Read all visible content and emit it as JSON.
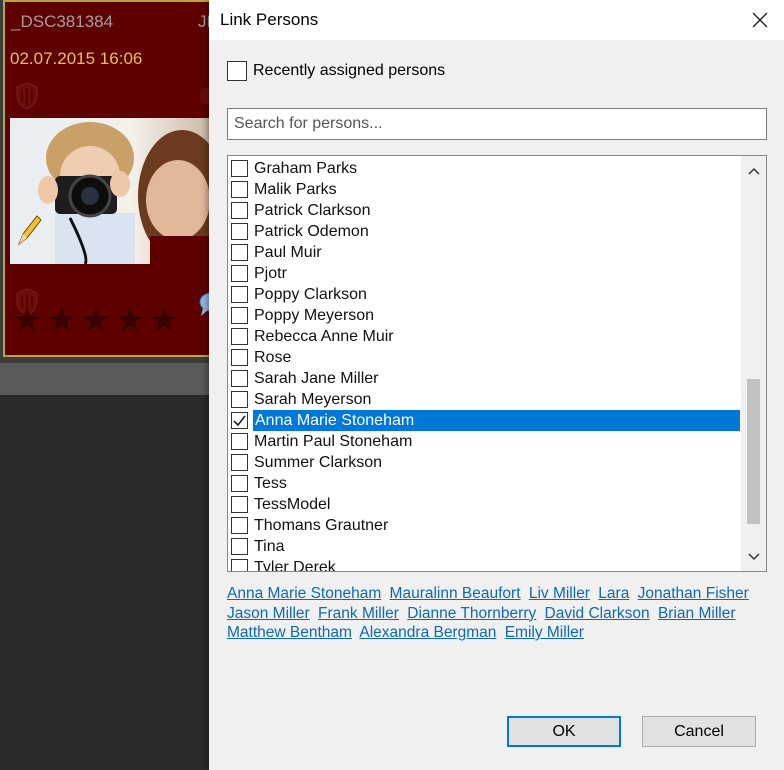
{
  "background": {
    "thumbnail": {
      "filename": "_DSC381384",
      "ext": "JF",
      "date": "02.07.2015 16:06",
      "stars_filled": 0
    }
  },
  "dialog": {
    "title": "Link Persons",
    "close_icon": "close-icon",
    "recent_label": "Recently assigned persons",
    "recent_checked": false,
    "search_placeholder": "Search for persons...",
    "persons": [
      {
        "name": "Graham Parks",
        "checked": false
      },
      {
        "name": "Malik Parks",
        "checked": false
      },
      {
        "name": "Patrick Clarkson",
        "checked": false
      },
      {
        "name": "Patrick Odemon",
        "checked": false
      },
      {
        "name": "Paul Muir",
        "checked": false
      },
      {
        "name": "Pjotr",
        "checked": false
      },
      {
        "name": "Poppy Clarkson",
        "checked": false
      },
      {
        "name": "Poppy Meyerson",
        "checked": false
      },
      {
        "name": "Rebecca Anne Muir",
        "checked": false
      },
      {
        "name": "Rose",
        "checked": false
      },
      {
        "name": "Sarah Jane Miller",
        "checked": false
      },
      {
        "name": "Sarah Meyerson",
        "checked": false
      },
      {
        "name": "Anna Marie Stoneham",
        "checked": true,
        "selected": true
      },
      {
        "name": "Martin Paul Stoneham",
        "checked": false
      },
      {
        "name": "Summer Clarkson",
        "checked": false
      },
      {
        "name": "Tess",
        "checked": false
      },
      {
        "name": "TessModel",
        "checked": false
      },
      {
        "name": "Thomans Grautner",
        "checked": false
      },
      {
        "name": "Tina",
        "checked": false
      },
      {
        "name": "Tyler Derek",
        "checked": false
      }
    ],
    "links": [
      "Anna Marie Stoneham",
      "Mauralinn Beaufort",
      "Liv Miller",
      "Lara",
      "Jonathan Fisher",
      "Jason Miller",
      "Frank Miller",
      "Dianne Thornberry",
      "David Clarkson",
      "Brian Miller",
      "Matthew Bentham",
      "Alexandra Bergman",
      "Emily Miller"
    ],
    "ok_label": "OK",
    "cancel_label": "Cancel",
    "colors": {
      "selection": "#0078d7",
      "link": "#0f69b4"
    }
  }
}
